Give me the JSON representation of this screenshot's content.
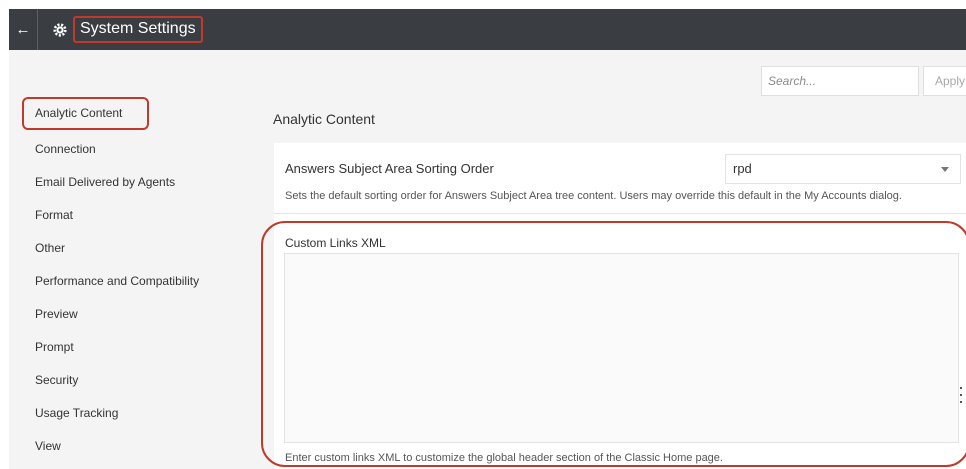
{
  "header": {
    "back_icon": "back-arrow-icon",
    "settings_icon": "gear-icon",
    "title": "System Settings"
  },
  "search": {
    "placeholder": "Search...",
    "apply_label": "Apply"
  },
  "sidebar": {
    "items": [
      {
        "label": "Analytic Content",
        "active": true
      },
      {
        "label": "Connection"
      },
      {
        "label": "Email Delivered by Agents"
      },
      {
        "label": "Format"
      },
      {
        "label": "Other"
      },
      {
        "label": "Performance and Compatibility"
      },
      {
        "label": "Preview"
      },
      {
        "label": "Prompt"
      },
      {
        "label": "Security"
      },
      {
        "label": "Usage Tracking"
      },
      {
        "label": "View"
      }
    ]
  },
  "main": {
    "section_title": "Analytic Content",
    "sorting": {
      "label": "Answers Subject Area Sorting Order",
      "value": "rpd",
      "description": "Sets the default sorting order for Answers Subject Area tree content. Users may override this default in the My Accounts dialog."
    },
    "custom_links": {
      "label": "Custom Links XML",
      "value": "",
      "description": "Enter custom links XML to customize the global header section of the Classic Home page."
    }
  },
  "colors": {
    "header_bg": "#3a3e42",
    "highlight": "#c0392b",
    "page_bg": "#f4f4f4"
  }
}
